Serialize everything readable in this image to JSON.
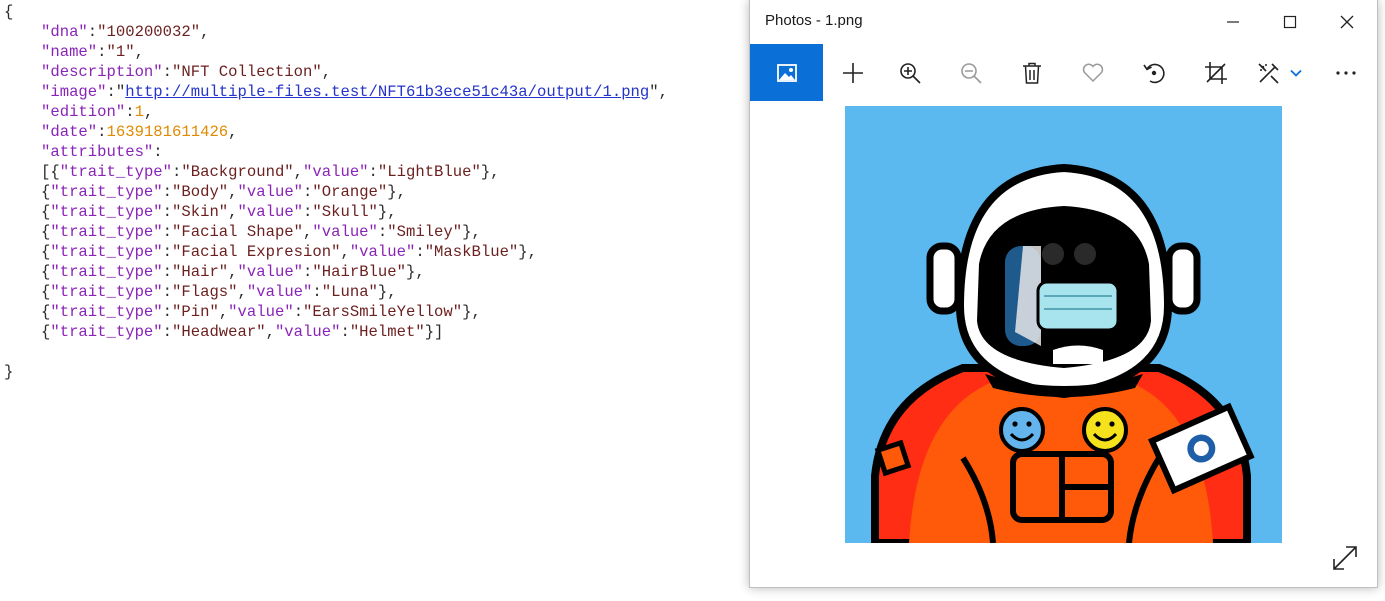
{
  "json_viewer": {
    "dna_key": "\"dna\"",
    "dna_value": "\"100200032\"",
    "name_key": "\"name\"",
    "name_value": "\"1\"",
    "description_key": "\"description\"",
    "description_value": "\"NFT Collection\"",
    "image_key": "\"image\"",
    "image_value": "http://multiple-files.test/NFT61b3ece51c43a/output/1.png",
    "edition_key": "\"edition\"",
    "edition_value": "1",
    "date_key": "\"date\"",
    "date_value": "1639181611426",
    "attributes_key": "\"attributes\"",
    "trait_type_key": "\"trait_type\"",
    "value_key": "\"value\"",
    "attributes": [
      {
        "trait_type": "\"Background\"",
        "value": "\"LightBlue\""
      },
      {
        "trait_type": "\"Body\"",
        "value": "\"Orange\""
      },
      {
        "trait_type": "\"Skin\"",
        "value": "\"Skull\""
      },
      {
        "trait_type": "\"Facial Shape\"",
        "value": "\"Smiley\""
      },
      {
        "trait_type": "\"Facial Expresion\"",
        "value": "\"MaskBlue\""
      },
      {
        "trait_type": "\"Hair\"",
        "value": "\"HairBlue\""
      },
      {
        "trait_type": "\"Flags\"",
        "value": "\"Luna\""
      },
      {
        "trait_type": "\"Pin\"",
        "value": "\"EarsSmileYellow\""
      },
      {
        "trait_type": "\"Headwear\"",
        "value": "\"Helmet\""
      }
    ]
  },
  "photos_window": {
    "title": "Photos - 1.png",
    "toolbar_icons": [
      "picture-icon",
      "add-icon",
      "zoom-in-icon",
      "zoom-out-icon",
      "delete-icon",
      "favorite-icon",
      "rotate-icon",
      "crop-icon",
      "edit-icon",
      "chevron-down-icon",
      "more-icon"
    ],
    "image_icons": [
      "astronaut-helmet",
      "smiley-pin-blue",
      "smiley-pin-yellow",
      "flag-patch-luna",
      "face-mask-blue"
    ],
    "colors": {
      "accent": "#0a6fd6",
      "image_background": "#5bb9ef",
      "suit_orange": "#ff5a0a",
      "suit_red": "#ff2d14",
      "mask_blue": "#a8e4ee",
      "pin_yellow": "#f6e21c",
      "pin_blue": "#64b5ee"
    }
  }
}
